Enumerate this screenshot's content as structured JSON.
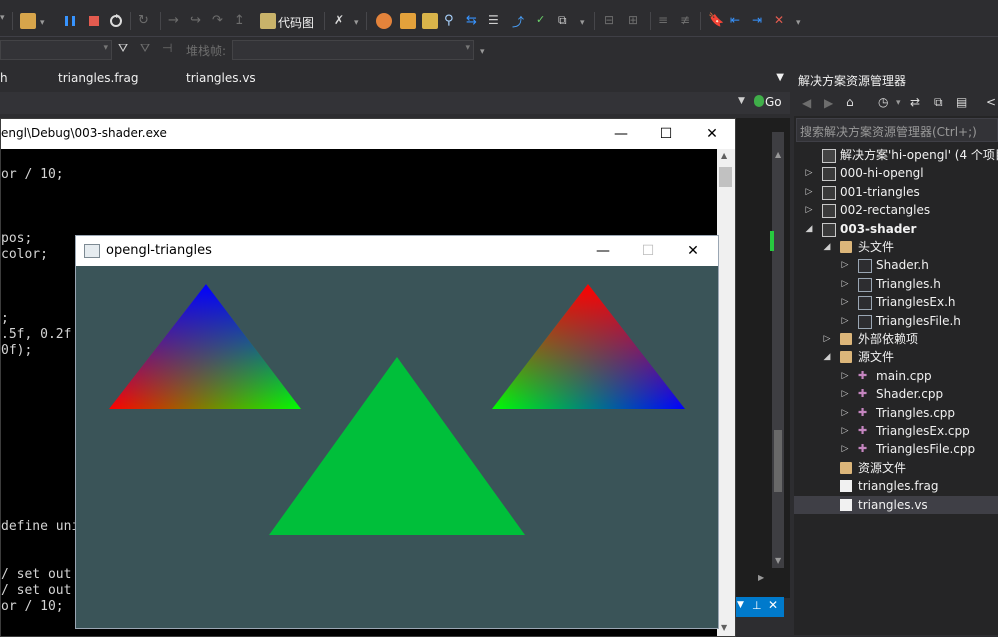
{
  "toolbar": {
    "code_map_label": "代码图",
    "stack_frame_label": "堆栈帧:"
  },
  "tabs": [
    {
      "label": "h"
    },
    {
      "label": "triangles.frag"
    },
    {
      "label": "triangles.vs"
    }
  ],
  "nav": {
    "go_label": "Go"
  },
  "console": {
    "title": "engl\\Debug\\003-shader.exe",
    "lines": [
      "or / 10;",
      "",
      "",
      "",
      "pos;",
      "color;",
      "",
      "",
      "",
      ";",
      ".5f, 0.2f",
      "0f);",
      "",
      "",
      "",
      "",
      "",
      "",
      "",
      "",
      "",
      "",
      "define uni",
      "",
      "",
      "/ set out",
      "/ set out",
      "or / 10;"
    ]
  },
  "gl_window": {
    "title": "opengl-triangles",
    "background": "#3a5458",
    "triangle_green": "#00bf3a"
  },
  "solution_explorer": {
    "title": "解决方案资源管理器",
    "search_placeholder": "搜索解决方案资源管理器(Ctrl+;)",
    "items": [
      {
        "label": "解决方案'hi-opengl' (4 个项目)",
        "icon": "solution-icon"
      },
      {
        "label": "000-hi-opengl",
        "icon": "project-icon"
      },
      {
        "label": "001-triangles",
        "icon": "project-icon"
      },
      {
        "label": "002-rectangles",
        "icon": "project-icon"
      },
      {
        "label": "003-shader",
        "icon": "project-icon"
      },
      {
        "label": "头文件",
        "icon": "folder-icon"
      },
      {
        "label": "Shader.h",
        "icon": "header-file-icon"
      },
      {
        "label": "Triangles.h",
        "icon": "header-file-icon"
      },
      {
        "label": "TrianglesEx.h",
        "icon": "header-file-icon"
      },
      {
        "label": "TrianglesFile.h",
        "icon": "header-file-icon"
      },
      {
        "label": "外部依赖项",
        "icon": "folder-icon"
      },
      {
        "label": "源文件",
        "icon": "folder-icon"
      },
      {
        "label": "main.cpp",
        "icon": "cpp-file-icon"
      },
      {
        "label": "Shader.cpp",
        "icon": "cpp-file-icon"
      },
      {
        "label": "Triangles.cpp",
        "icon": "cpp-file-icon"
      },
      {
        "label": "TrianglesEx.cpp",
        "icon": "cpp-file-icon"
      },
      {
        "label": "TrianglesFile.cpp",
        "icon": "cpp-file-icon"
      },
      {
        "label": "资源文件",
        "icon": "folder-icon"
      },
      {
        "label": "triangles.frag",
        "icon": "file-icon"
      },
      {
        "label": "triangles.vs",
        "icon": "file-icon"
      }
    ]
  }
}
